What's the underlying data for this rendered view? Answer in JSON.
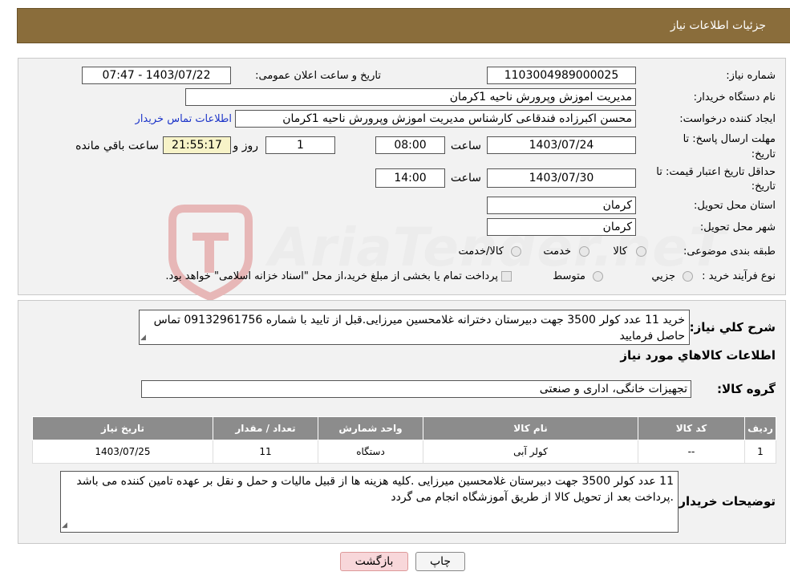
{
  "header": {
    "title": "جزئیات اطلاعات نیاز"
  },
  "form": {
    "need_number": {
      "label": "شماره نیاز:",
      "value": "1103004989000025"
    },
    "announce_datetime": {
      "label": "تاریخ و ساعت اعلان عمومی:",
      "value": "1403/07/22 - 07:47"
    },
    "buyer_org": {
      "label": "نام دستگاه خریدار:",
      "value": "مدیریت اموزش وپرورش ناحیه 1کرمان"
    },
    "requester": {
      "label": "ایجاد کننده درخواست:",
      "value": "محسن اکبرزاده فندقاعی کارشناس  مدیریت اموزش وپرورش ناحیه 1کرمان",
      "contact_link": "اطلاعات تماس خریدار"
    },
    "reply_deadline": {
      "label": "مهلت ارسال پاسخ: تا تاریخ:",
      "date": "1403/07/24",
      "time_label": "ساعت",
      "time": "08:00",
      "days": "1",
      "days_label": "روز و",
      "remaining": "21:55:17",
      "remaining_label": "ساعت باقي مانده"
    },
    "price_validity": {
      "label": "حداقل تاریخ اعتبار قیمت: تا تاریخ:",
      "date": "1403/07/30",
      "time_label": "ساعت",
      "time": "14:00"
    },
    "province": {
      "label": "استان محل تحویل:",
      "value": "کرمان"
    },
    "city": {
      "label": "شهر محل تحویل:",
      "value": "کرمان"
    },
    "category": {
      "label": "طبقه بندی موضوعی:",
      "options": [
        "کالا",
        "خدمت",
        "کالا/خدمت"
      ]
    },
    "process": {
      "label": "نوع فرآیند خرید :",
      "options": [
        "جزیي",
        "متوسط"
      ],
      "note": "پرداخت تمام یا بخشی از مبلغ خرید،از محل \"اسناد خزانه اسلامی\" خواهد بود."
    }
  },
  "summary": {
    "label": "شرح كلي نياز:",
    "value": "خرید 11 عدد کولر 3500 جهت دبیرستان دخترانه غلامحسین میرزایی.قبل از تایید با شماره 09132961756 تماس حاصل فرمایید"
  },
  "goods": {
    "section_title": "اطلاعات کالاهاي مورد نياز",
    "group_label": "گروه کالا:",
    "group_value": "تجهیزات خانگی، اداری و صنعتی",
    "columns": [
      "ردیف",
      "کد کالا",
      "نام کالا",
      "واحد شمارش",
      "تعداد / مقدار",
      "تاریخ نیاز"
    ],
    "rows": [
      {
        "row": "1",
        "code": "--",
        "name": "کولر آبی",
        "unit": "دستگاه",
        "qty": "11",
        "date": "1403/07/25"
      }
    ]
  },
  "buyer_notes": {
    "label": "توضیحات خریدار:",
    "value": "11 عدد کولر 3500 جهت دبیرستان غلامحسین میرزایی .کلیه هزینه ها از قبیل مالیات و حمل و نقل بر عهده تامین کننده می باشد .پرداخت بعد از تحویل کالا از طریق آموزشگاه انجام می گردد"
  },
  "buttons": {
    "print": "چاپ",
    "back": "بازگشت"
  },
  "watermark": {
    "text": "AriaTender.neT"
  },
  "colors": {
    "header_bg": "#8a6d3b",
    "link": "#1d35c9",
    "table_header": "#8c8c8c",
    "back_button": "#f8d7da"
  }
}
